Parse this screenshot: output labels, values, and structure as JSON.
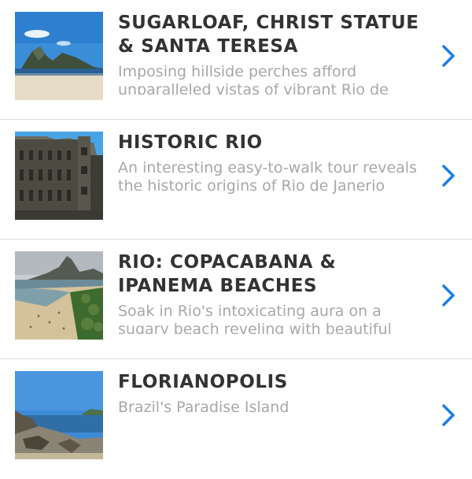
{
  "tours": [
    {
      "title": "SUGARLOAF, CHRIST STATUE & SANTA TERESA",
      "description": "Imposing hillside perches afford unparalleled vistas of vibrant Rio de Janeiro.",
      "thumbnail_icon": "sugarloaf-photo"
    },
    {
      "title": "HISTORIC RIO",
      "description": "An interesting easy-to-walk tour reveals the historic origins of Rio de Janerio",
      "thumbnail_icon": "historic-building-photo"
    },
    {
      "title": "RIO: COPACABANA & IPANEMA BEACHES",
      "description": "Soak in Rio's intoxicating aura on a sugary beach reveling with beautiful locals",
      "thumbnail_icon": "beach-photo"
    },
    {
      "title": "FLORIANOPOLIS",
      "description": "Brazil's Paradise Island",
      "thumbnail_icon": "coast-rocks-photo"
    }
  ],
  "colors": {
    "title": "#333333",
    "description": "#a8a8a8",
    "chevron": "#1a7ee6",
    "divider": "#dcdcdc"
  },
  "chevron_icon": "chevron-right-icon"
}
